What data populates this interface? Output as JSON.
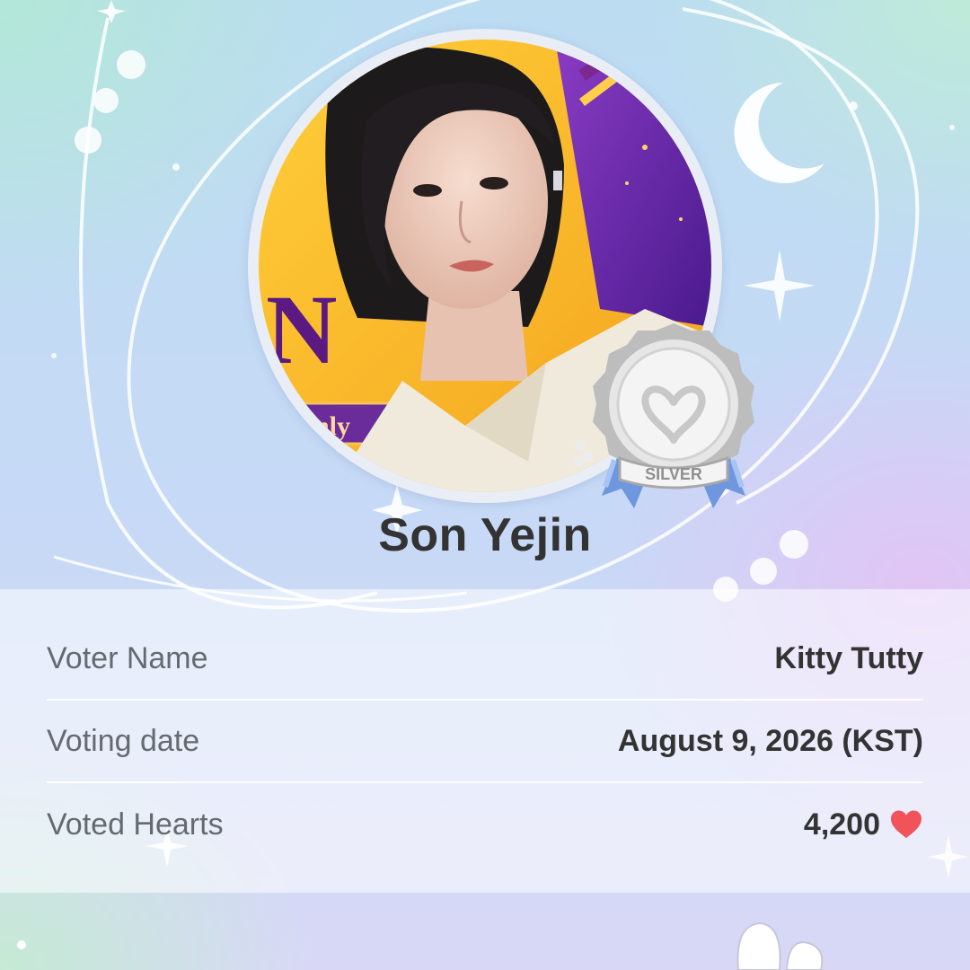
{
  "artist": {
    "name": "Son Yejin"
  },
  "badge": {
    "label": "SILVER"
  },
  "details": {
    "voter_name_label": "Voter Name",
    "voter_name_value": "Kitty Tutty",
    "voting_date_label": "Voting date",
    "voting_date_value": "August 9, 2026 (KST)",
    "hearts_label": "Voted Hearts",
    "hearts_value": "4,200"
  },
  "photo_text": {
    "letter": "N",
    "tag": "nly"
  },
  "colors": {
    "heart": "#f0545a",
    "text_dark": "#333333",
    "text_label": "#666a70",
    "badge_silver": "#c9c9c9",
    "ribbon_blue": "#6f97df"
  },
  "icons": [
    "moon-icon",
    "sparkle-icon",
    "heart-icon",
    "silver-medal-icon",
    "bunny-ears-icon"
  ]
}
